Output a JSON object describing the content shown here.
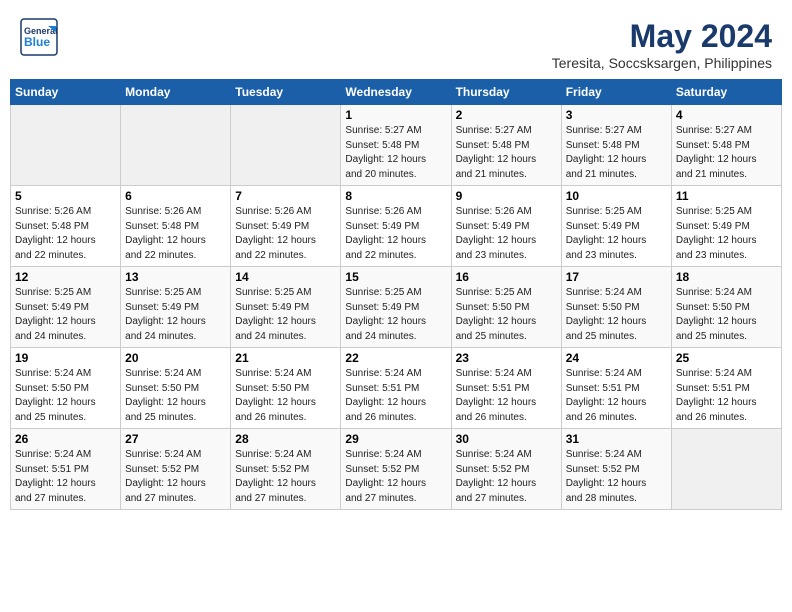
{
  "logo": {
    "general": "General",
    "blue": "Blue"
  },
  "title": "May 2024",
  "subtitle": "Teresita, Soccsksargen, Philippines",
  "days_of_week": [
    "Sunday",
    "Monday",
    "Tuesday",
    "Wednesday",
    "Thursday",
    "Friday",
    "Saturday"
  ],
  "weeks": [
    [
      {
        "day": "",
        "info": ""
      },
      {
        "day": "",
        "info": ""
      },
      {
        "day": "",
        "info": ""
      },
      {
        "day": "1",
        "info": "Sunrise: 5:27 AM\nSunset: 5:48 PM\nDaylight: 12 hours\nand 20 minutes."
      },
      {
        "day": "2",
        "info": "Sunrise: 5:27 AM\nSunset: 5:48 PM\nDaylight: 12 hours\nand 21 minutes."
      },
      {
        "day": "3",
        "info": "Sunrise: 5:27 AM\nSunset: 5:48 PM\nDaylight: 12 hours\nand 21 minutes."
      },
      {
        "day": "4",
        "info": "Sunrise: 5:27 AM\nSunset: 5:48 PM\nDaylight: 12 hours\nand 21 minutes."
      }
    ],
    [
      {
        "day": "5",
        "info": "Sunrise: 5:26 AM\nSunset: 5:48 PM\nDaylight: 12 hours\nand 22 minutes."
      },
      {
        "day": "6",
        "info": "Sunrise: 5:26 AM\nSunset: 5:48 PM\nDaylight: 12 hours\nand 22 minutes."
      },
      {
        "day": "7",
        "info": "Sunrise: 5:26 AM\nSunset: 5:49 PM\nDaylight: 12 hours\nand 22 minutes."
      },
      {
        "day": "8",
        "info": "Sunrise: 5:26 AM\nSunset: 5:49 PM\nDaylight: 12 hours\nand 22 minutes."
      },
      {
        "day": "9",
        "info": "Sunrise: 5:26 AM\nSunset: 5:49 PM\nDaylight: 12 hours\nand 23 minutes."
      },
      {
        "day": "10",
        "info": "Sunrise: 5:25 AM\nSunset: 5:49 PM\nDaylight: 12 hours\nand 23 minutes."
      },
      {
        "day": "11",
        "info": "Sunrise: 5:25 AM\nSunset: 5:49 PM\nDaylight: 12 hours\nand 23 minutes."
      }
    ],
    [
      {
        "day": "12",
        "info": "Sunrise: 5:25 AM\nSunset: 5:49 PM\nDaylight: 12 hours\nand 24 minutes."
      },
      {
        "day": "13",
        "info": "Sunrise: 5:25 AM\nSunset: 5:49 PM\nDaylight: 12 hours\nand 24 minutes."
      },
      {
        "day": "14",
        "info": "Sunrise: 5:25 AM\nSunset: 5:49 PM\nDaylight: 12 hours\nand 24 minutes."
      },
      {
        "day": "15",
        "info": "Sunrise: 5:25 AM\nSunset: 5:49 PM\nDaylight: 12 hours\nand 24 minutes."
      },
      {
        "day": "16",
        "info": "Sunrise: 5:25 AM\nSunset: 5:50 PM\nDaylight: 12 hours\nand 25 minutes."
      },
      {
        "day": "17",
        "info": "Sunrise: 5:24 AM\nSunset: 5:50 PM\nDaylight: 12 hours\nand 25 minutes."
      },
      {
        "day": "18",
        "info": "Sunrise: 5:24 AM\nSunset: 5:50 PM\nDaylight: 12 hours\nand 25 minutes."
      }
    ],
    [
      {
        "day": "19",
        "info": "Sunrise: 5:24 AM\nSunset: 5:50 PM\nDaylight: 12 hours\nand 25 minutes."
      },
      {
        "day": "20",
        "info": "Sunrise: 5:24 AM\nSunset: 5:50 PM\nDaylight: 12 hours\nand 25 minutes."
      },
      {
        "day": "21",
        "info": "Sunrise: 5:24 AM\nSunset: 5:50 PM\nDaylight: 12 hours\nand 26 minutes."
      },
      {
        "day": "22",
        "info": "Sunrise: 5:24 AM\nSunset: 5:51 PM\nDaylight: 12 hours\nand 26 minutes."
      },
      {
        "day": "23",
        "info": "Sunrise: 5:24 AM\nSunset: 5:51 PM\nDaylight: 12 hours\nand 26 minutes."
      },
      {
        "day": "24",
        "info": "Sunrise: 5:24 AM\nSunset: 5:51 PM\nDaylight: 12 hours\nand 26 minutes."
      },
      {
        "day": "25",
        "info": "Sunrise: 5:24 AM\nSunset: 5:51 PM\nDaylight: 12 hours\nand 26 minutes."
      }
    ],
    [
      {
        "day": "26",
        "info": "Sunrise: 5:24 AM\nSunset: 5:51 PM\nDaylight: 12 hours\nand 27 minutes."
      },
      {
        "day": "27",
        "info": "Sunrise: 5:24 AM\nSunset: 5:52 PM\nDaylight: 12 hours\nand 27 minutes."
      },
      {
        "day": "28",
        "info": "Sunrise: 5:24 AM\nSunset: 5:52 PM\nDaylight: 12 hours\nand 27 minutes."
      },
      {
        "day": "29",
        "info": "Sunrise: 5:24 AM\nSunset: 5:52 PM\nDaylight: 12 hours\nand 27 minutes."
      },
      {
        "day": "30",
        "info": "Sunrise: 5:24 AM\nSunset: 5:52 PM\nDaylight: 12 hours\nand 27 minutes."
      },
      {
        "day": "31",
        "info": "Sunrise: 5:24 AM\nSunset: 5:52 PM\nDaylight: 12 hours\nand 28 minutes."
      },
      {
        "day": "",
        "info": ""
      }
    ]
  ]
}
